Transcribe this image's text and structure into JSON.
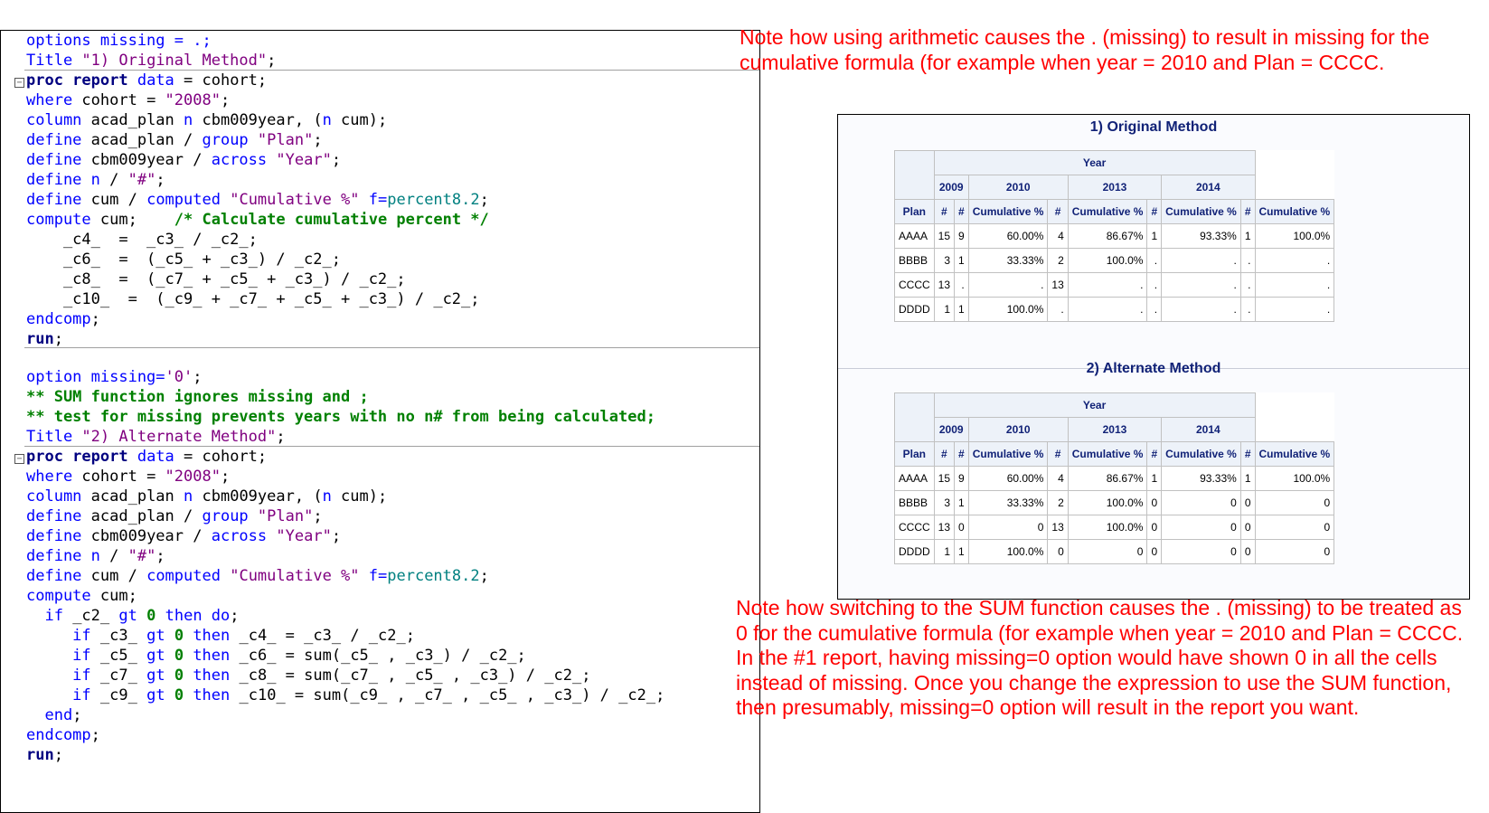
{
  "code_block_1": [
    [
      [
        "options missing = .;",
        "k"
      ]
    ],
    [
      [
        "Title ",
        "k"
      ],
      [
        "\"1) Original Method\"",
        "s"
      ],
      [
        ";",
        "p"
      ]
    ],
    [
      [
        "proc report",
        "b"
      ],
      [
        " data",
        "k"
      ],
      [
        " = cohort;",
        "p"
      ]
    ],
    [
      [
        "where",
        "k"
      ],
      [
        " cohort = ",
        "p"
      ],
      [
        "\"2008\"",
        "s"
      ],
      [
        ";",
        "p"
      ]
    ],
    [
      [
        "column",
        "k"
      ],
      [
        " acad_plan ",
        "p"
      ],
      [
        "n",
        "k"
      ],
      [
        " cbm009year, (",
        "p"
      ],
      [
        "n",
        "k"
      ],
      [
        " cum);",
        "p"
      ]
    ],
    [
      [
        "define",
        "k"
      ],
      [
        " acad_plan / ",
        "p"
      ],
      [
        "group",
        "k"
      ],
      [
        " ",
        "p"
      ],
      [
        "\"Plan\"",
        "s"
      ],
      [
        ";",
        "p"
      ]
    ],
    [
      [
        "define",
        "k"
      ],
      [
        " cbm009year / ",
        "p"
      ],
      [
        "across",
        "k"
      ],
      [
        " ",
        "p"
      ],
      [
        "\"Year\"",
        "s"
      ],
      [
        ";",
        "p"
      ]
    ],
    [
      [
        "define",
        "k"
      ],
      [
        " ",
        "p"
      ],
      [
        "n",
        "k"
      ],
      [
        " / ",
        "p"
      ],
      [
        "\"#\"",
        "s"
      ],
      [
        ";",
        "p"
      ]
    ],
    [
      [
        "define",
        "k"
      ],
      [
        " cum / ",
        "p"
      ],
      [
        "computed",
        "k"
      ],
      [
        " ",
        "p"
      ],
      [
        "\"Cumulative %\"",
        "s"
      ],
      [
        " ",
        "p"
      ],
      [
        "f=",
        "k"
      ],
      [
        "percent8.2",
        "n"
      ],
      [
        ";",
        "p"
      ]
    ],
    [
      [
        "compute",
        "k"
      ],
      [
        " cum;    ",
        "p"
      ],
      [
        "/* Calculate cumulative percent */",
        "c"
      ]
    ],
    [
      [
        "    _c4_  =  _c3_ / _c2_;",
        "p"
      ]
    ],
    [
      [
        "    _c6_  =  (_c5_ + _c3_) / _c2_;",
        "p"
      ]
    ],
    [
      [
        "    _c8_  =  (_c7_ + _c5_ + _c3_) / _c2_;",
        "p"
      ]
    ],
    [
      [
        "    _c10_  =  (_c9_ + _c7_ + _c5_ + _c3_) / _c2_;",
        "p"
      ]
    ],
    [
      [
        "endcomp",
        "k"
      ],
      [
        ";",
        "p"
      ]
    ],
    [
      [
        "run",
        "b"
      ],
      [
        ";",
        "p"
      ]
    ]
  ],
  "code_block_2": [
    [
      [
        "option missing=",
        "k"
      ],
      [
        "'0'",
        "s"
      ],
      [
        ";",
        "p"
      ]
    ],
    [
      [
        "** SUM function ignores missing and ;",
        "c"
      ]
    ],
    [
      [
        "** test for missing prevents years with no n# from being calculated;",
        "c"
      ]
    ],
    [
      [
        "Title ",
        "k"
      ],
      [
        "\"2) Alternate Method\"",
        "s"
      ],
      [
        ";",
        "p"
      ]
    ],
    [
      [
        "proc report",
        "b"
      ],
      [
        " data",
        "k"
      ],
      [
        " = cohort;",
        "p"
      ]
    ],
    [
      [
        "where",
        "k"
      ],
      [
        " cohort = ",
        "p"
      ],
      [
        "\"2008\"",
        "s"
      ],
      [
        ";",
        "p"
      ]
    ],
    [
      [
        "column",
        "k"
      ],
      [
        " acad_plan ",
        "p"
      ],
      [
        "n",
        "k"
      ],
      [
        " cbm009year, (",
        "p"
      ],
      [
        "n",
        "k"
      ],
      [
        " cum);",
        "p"
      ]
    ],
    [
      [
        "define",
        "k"
      ],
      [
        " acad_plan / ",
        "p"
      ],
      [
        "group",
        "k"
      ],
      [
        " ",
        "p"
      ],
      [
        "\"Plan\"",
        "s"
      ],
      [
        ";",
        "p"
      ]
    ],
    [
      [
        "define",
        "k"
      ],
      [
        " cbm009year / ",
        "p"
      ],
      [
        "across",
        "k"
      ],
      [
        " ",
        "p"
      ],
      [
        "\"Year\"",
        "s"
      ],
      [
        ";",
        "p"
      ]
    ],
    [
      [
        "define",
        "k"
      ],
      [
        " ",
        "p"
      ],
      [
        "n",
        "k"
      ],
      [
        " / ",
        "p"
      ],
      [
        "\"#\"",
        "s"
      ],
      [
        ";",
        "p"
      ]
    ],
    [
      [
        "define",
        "k"
      ],
      [
        " cum / ",
        "p"
      ],
      [
        "computed",
        "k"
      ],
      [
        " ",
        "p"
      ],
      [
        "\"Cumulative %\"",
        "s"
      ],
      [
        " ",
        "p"
      ],
      [
        "f=",
        "k"
      ],
      [
        "percent8.2",
        "n"
      ],
      [
        ";",
        "p"
      ]
    ],
    [
      [
        "compute",
        "k"
      ],
      [
        " cum;",
        "p"
      ]
    ],
    [
      [
        "  if",
        "k"
      ],
      [
        " _c2_ ",
        "p"
      ],
      [
        "gt",
        "k"
      ],
      [
        " ",
        "p"
      ],
      [
        "0",
        "d"
      ],
      [
        " ",
        "p"
      ],
      [
        "then do",
        "k"
      ],
      [
        ";",
        "p"
      ]
    ],
    [
      [
        "     if",
        "k"
      ],
      [
        " _c3_ ",
        "p"
      ],
      [
        "gt",
        "k"
      ],
      [
        " ",
        "p"
      ],
      [
        "0",
        "d"
      ],
      [
        " ",
        "p"
      ],
      [
        "then",
        "k"
      ],
      [
        " _c4_ = _c3_ / _c2_;",
        "p"
      ]
    ],
    [
      [
        "     if",
        "k"
      ],
      [
        " _c5_ ",
        "p"
      ],
      [
        "gt",
        "k"
      ],
      [
        " ",
        "p"
      ],
      [
        "0",
        "d"
      ],
      [
        " ",
        "p"
      ],
      [
        "then",
        "k"
      ],
      [
        " _c6_ = sum(_c5_ , _c3_) / _c2_;",
        "p"
      ]
    ],
    [
      [
        "     if",
        "k"
      ],
      [
        " _c7_ ",
        "p"
      ],
      [
        "gt",
        "k"
      ],
      [
        " ",
        "p"
      ],
      [
        "0",
        "d"
      ],
      [
        " ",
        "p"
      ],
      [
        "then",
        "k"
      ],
      [
        " _c8_ = sum(_c7_ , _c5_ , _c3_) / _c2_;",
        "p"
      ]
    ],
    [
      [
        "     if",
        "k"
      ],
      [
        " _c9_ ",
        "p"
      ],
      [
        "gt",
        "k"
      ],
      [
        " ",
        "p"
      ],
      [
        "0",
        "d"
      ],
      [
        " ",
        "p"
      ],
      [
        "then",
        "k"
      ],
      [
        " _c10_ = sum(_c9_ , _c7_ , _c5_ , _c3_) / _c2_;",
        "p"
      ]
    ],
    [
      [
        "  end",
        "k"
      ],
      [
        ";",
        "p"
      ]
    ],
    [
      [
        "endcomp",
        "k"
      ],
      [
        ";",
        "p"
      ]
    ],
    [
      [
        "run",
        "b"
      ],
      [
        ";",
        "p"
      ]
    ]
  ],
  "notes": {
    "top": "Note how using arithmetic causes the . (missing) to result in missing for the cumulative formula (for example when year = 2010 and Plan = CCCC.",
    "bottom": "Note how switching to the SUM function causes the . (missing) to be treated as 0 for the cumulative formula (for example when year = 2010 and Plan = CCCC. In the #1 report, having missing=0 option would have shown 0 in all the cells instead of missing. Once you change the expression to use the SUM function, then presumably, missing=0 option will result in the report you want."
  },
  "report": {
    "year_header": "Year",
    "years": [
      "2009",
      "2010",
      "2013",
      "2014"
    ],
    "col_plan": "Plan",
    "col_n": "#",
    "col_cum": "Cumulative %",
    "tables": [
      {
        "title": "1) Original Method",
        "rows": [
          [
            "AAAA",
            "15",
            "9",
            "60.00%",
            "4",
            "86.67%",
            "1",
            "93.33%",
            "1",
            "100.0%"
          ],
          [
            "BBBB",
            "3",
            "1",
            "33.33%",
            "2",
            "100.0%",
            ".",
            ".",
            ".",
            "."
          ],
          [
            "CCCC",
            "13",
            ".",
            ".",
            "13",
            ".",
            ".",
            ".",
            ".",
            "."
          ],
          [
            "DDDD",
            "1",
            "1",
            "100.0%",
            ".",
            ".",
            ".",
            ".",
            ".",
            "."
          ]
        ]
      },
      {
        "title": "2) Alternate Method",
        "rows": [
          [
            "AAAA",
            "15",
            "9",
            "60.00%",
            "4",
            "86.67%",
            "1",
            "93.33%",
            "1",
            "100.0%"
          ],
          [
            "BBBB",
            "3",
            "1",
            "33.33%",
            "2",
            "100.0%",
            "0",
            "0",
            "0",
            "0"
          ],
          [
            "CCCC",
            "13",
            "0",
            "0",
            "13",
            "100.0%",
            "0",
            "0",
            "0",
            "0"
          ],
          [
            "DDDD",
            "1",
            "1",
            "100.0%",
            "0",
            "0",
            "0",
            "0",
            "0",
            "0"
          ]
        ]
      }
    ]
  }
}
